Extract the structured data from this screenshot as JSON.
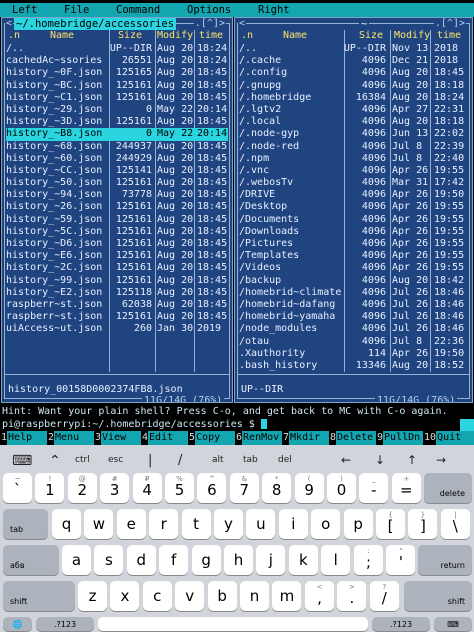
{
  "menu": {
    "items": [
      "Left",
      "File",
      "Command",
      "Options",
      "Right"
    ]
  },
  "left_panel": {
    "path": "~/.homebridge/accessories",
    "ctrl": ".[^]>",
    "ctrl_left": "<",
    "headers": {
      "n": ".n",
      "name": "Name",
      "size": "Size",
      "modify": "Modify",
      "time": "time"
    },
    "rows": [
      {
        "name": "/..",
        "size": "UP--DIR",
        "date": "Aug 20",
        "time": "18:24"
      },
      {
        "name": " cachedAc~ssories",
        "size": "26551",
        "date": "Aug 20",
        "time": "18:24"
      },
      {
        "name": " history_~0F.json",
        "size": "125165",
        "date": "Aug 20",
        "time": "18:45"
      },
      {
        "name": " history_~BC.json",
        "size": "125161",
        "date": "Aug 20",
        "time": "18:45"
      },
      {
        "name": " history_~C1.json",
        "size": "125161",
        "date": "Aug 20",
        "time": "18:45"
      },
      {
        "name": " history_~29.json",
        "size": "0",
        "date": "May 22",
        "time": "20:14"
      },
      {
        "name": " history_~3D.json",
        "size": "125161",
        "date": "Aug 20",
        "time": "18:45"
      },
      {
        "name": " history_~B8.json",
        "size": "0",
        "date": "May 22",
        "time": "20:14"
      },
      {
        "name": " history_~68.json",
        "size": "244937",
        "date": "Aug 20",
        "time": "18:45"
      },
      {
        "name": " history_~60.json",
        "size": "244929",
        "date": "Aug 20",
        "time": "18:45"
      },
      {
        "name": " history_~CC.json",
        "size": "125141",
        "date": "Aug 20",
        "time": "18:45"
      },
      {
        "name": " history_~50.json",
        "size": "125161",
        "date": "Aug 20",
        "time": "18:45"
      },
      {
        "name": " history_~94.json",
        "size": "73778",
        "date": "Aug 20",
        "time": "18:45"
      },
      {
        "name": " history_~26.json",
        "size": "125161",
        "date": "Aug 20",
        "time": "18:45"
      },
      {
        "name": " history_~59.json",
        "size": "125161",
        "date": "Aug 20",
        "time": "18:45"
      },
      {
        "name": " history_~5C.json",
        "size": "125161",
        "date": "Aug 20",
        "time": "18:45"
      },
      {
        "name": " history_~D6.json",
        "size": "125161",
        "date": "Aug 20",
        "time": "18:45"
      },
      {
        "name": " history_~E6.json",
        "size": "125161",
        "date": "Aug 20",
        "time": "18:45"
      },
      {
        "name": " history_~2C.json",
        "size": "125161",
        "date": "Aug 20",
        "time": "18:45"
      },
      {
        "name": " history_~99.json",
        "size": "125161",
        "date": "Aug 20",
        "time": "18:45"
      },
      {
        "name": " history_~E2.json",
        "size": "125118",
        "date": "Aug 20",
        "time": "18:45"
      },
      {
        "name": " raspberr~st.json",
        "size": "62038",
        "date": "Aug 20",
        "time": "18:45"
      },
      {
        "name": " raspberr~st.json",
        "size": "125161",
        "date": "Aug 20",
        "time": "18:45"
      },
      {
        "name": " uiAccess~ut.json",
        "size": "260",
        "date": "Jan 30",
        "time": "2019"
      }
    ],
    "selected_index": 7,
    "status": "history_00158D0002374FB8.json",
    "usage": "11G/14G (76%)"
  },
  "right_panel": {
    "path": "~",
    "ctrl": ".[^]>",
    "ctrl_left": "<",
    "headers": {
      "n": ".n",
      "name": "Name",
      "size": "Size",
      "modify": "Modify",
      "time": "time"
    },
    "rows": [
      {
        "name": "/..",
        "size": "UP--DIR",
        "date": "Nov 13",
        "time": "2018"
      },
      {
        "name": "/.cache",
        "size": "4096",
        "date": "Dec 21",
        "time": "2018"
      },
      {
        "name": "/.config",
        "size": "4096",
        "date": "Aug 20",
        "time": "18:45"
      },
      {
        "name": "/.gnupg",
        "size": "4096",
        "date": "Aug 20",
        "time": "18:18"
      },
      {
        "name": "/.homebridge",
        "size": "16384",
        "date": "Aug 20",
        "time": "18:24"
      },
      {
        "name": "/.lgtv2",
        "size": "4096",
        "date": "Apr 27",
        "time": "22:31"
      },
      {
        "name": "/.local",
        "size": "4096",
        "date": "Aug 20",
        "time": "18:18"
      },
      {
        "name": "/.node-gyp",
        "size": "4096",
        "date": "Jun 13",
        "time": "22:02"
      },
      {
        "name": "/.node-red",
        "size": "4096",
        "date": "Jul  8",
        "time": "22:39"
      },
      {
        "name": "/.npm",
        "size": "4096",
        "date": "Jul  8",
        "time": "22:40"
      },
      {
        "name": "/.vnc",
        "size": "4096",
        "date": "Apr 26",
        "time": "19:55"
      },
      {
        "name": "/.webosTv",
        "size": "4096",
        "date": "Mar 31",
        "time": "17:42"
      },
      {
        "name": "/DRIVE",
        "size": "4096",
        "date": "Apr 26",
        "time": "19:50"
      },
      {
        "name": "/Desktop",
        "size": "4096",
        "date": "Apr 26",
        "time": "19:55"
      },
      {
        "name": "/Documents",
        "size": "4096",
        "date": "Apr 26",
        "time": "19:55"
      },
      {
        "name": "/Downloads",
        "size": "4096",
        "date": "Apr 26",
        "time": "19:55"
      },
      {
        "name": "/Pictures",
        "size": "4096",
        "date": "Apr 26",
        "time": "19:55"
      },
      {
        "name": "/Templates",
        "size": "4096",
        "date": "Apr 26",
        "time": "19:55"
      },
      {
        "name": "/Videos",
        "size": "4096",
        "date": "Apr 26",
        "time": "19:55"
      },
      {
        "name": "/backup",
        "size": "4096",
        "date": "Aug 20",
        "time": "18:42"
      },
      {
        "name": "/homebrid~climate",
        "size": "4096",
        "date": "Jul 26",
        "time": "18:46"
      },
      {
        "name": "/homebrid~dafang",
        "size": "4096",
        "date": "Jul 26",
        "time": "18:46"
      },
      {
        "name": "/homebrid~yamaha",
        "size": "4096",
        "date": "Jul 26",
        "time": "18:46"
      },
      {
        "name": "/node_modules",
        "size": "4096",
        "date": "Jul 26",
        "time": "18:46"
      },
      {
        "name": "/otau",
        "size": "4096",
        "date": "Jul  8",
        "time": "22:36"
      },
      {
        "name": " .Xauthority",
        "size": "114",
        "date": "Apr 26",
        "time": "19:50"
      },
      {
        "name": " .bash_history",
        "size": "13346",
        "date": "Aug 20",
        "time": "18:52"
      }
    ],
    "status": "UP--DIR",
    "usage": "11G/14G (76%)"
  },
  "hint": "Hint: Want your plain shell? Press C-o, and get back to MC with C-o again.",
  "prompt": "pi@raspberrypi:~/.homebridge/accessories $",
  "fkeys": [
    {
      "num": "1",
      "label": "Help"
    },
    {
      "num": "2",
      "label": "Menu"
    },
    {
      "num": "3",
      "label": "View"
    },
    {
      "num": "4",
      "label": "Edit"
    },
    {
      "num": "5",
      "label": "Copy"
    },
    {
      "num": "6",
      "label": "RenMov"
    },
    {
      "num": "7",
      "label": "Mkdir"
    },
    {
      "num": "8",
      "label": "Delete"
    },
    {
      "num": "9",
      "label": "PullDn"
    },
    {
      "num": "10",
      "label": "Quit"
    }
  ],
  "toolbar": {
    "ctrl": "ctrl",
    "esc": "esc",
    "alt": "alt",
    "tab": "tab",
    "del": "del"
  },
  "keyboard": {
    "row1": [
      {
        "sub": "~",
        "main": "`"
      },
      {
        "sub": "!",
        "main": "1"
      },
      {
        "sub": "@",
        "main": "2"
      },
      {
        "sub": "#",
        "main": "3"
      },
      {
        "sub": "₽",
        "main": "4"
      },
      {
        "sub": "%",
        "main": "5"
      },
      {
        "sub": "^",
        "main": "6"
      },
      {
        "sub": "&",
        "main": "7"
      },
      {
        "sub": "*",
        "main": "8"
      },
      {
        "sub": "(",
        "main": "9"
      },
      {
        "sub": ")",
        "main": "0"
      },
      {
        "sub": "_",
        "main": "-"
      },
      {
        "sub": "+",
        "main": "="
      }
    ],
    "delete": "delete",
    "tab": "tab",
    "row2": [
      "q",
      "w",
      "e",
      "r",
      "t",
      "y",
      "u",
      "i",
      "o",
      "p"
    ],
    "row2_extra": [
      {
        "sub": "{",
        "main": "["
      },
      {
        "sub": "}",
        "main": "]"
      },
      {
        "sub": "|",
        "main": "\\"
      }
    ],
    "lang": "абв",
    "row3": [
      "a",
      "s",
      "d",
      "f",
      "g",
      "h",
      "j",
      "k",
      "l"
    ],
    "row3_extra": [
      {
        "sub": ":",
        "main": ";"
      },
      {
        "sub": "\"",
        "main": "'"
      }
    ],
    "return": "return",
    "shift": "shift",
    "row4": [
      "z",
      "x",
      "c",
      "v",
      "b",
      "n",
      "m"
    ],
    "row4_extra": [
      {
        "sub": "<",
        "main": ","
      },
      {
        "sub": ">",
        "main": "."
      },
      {
        "sub": "?",
        "main": "/"
      }
    ],
    "num": ".?123"
  }
}
